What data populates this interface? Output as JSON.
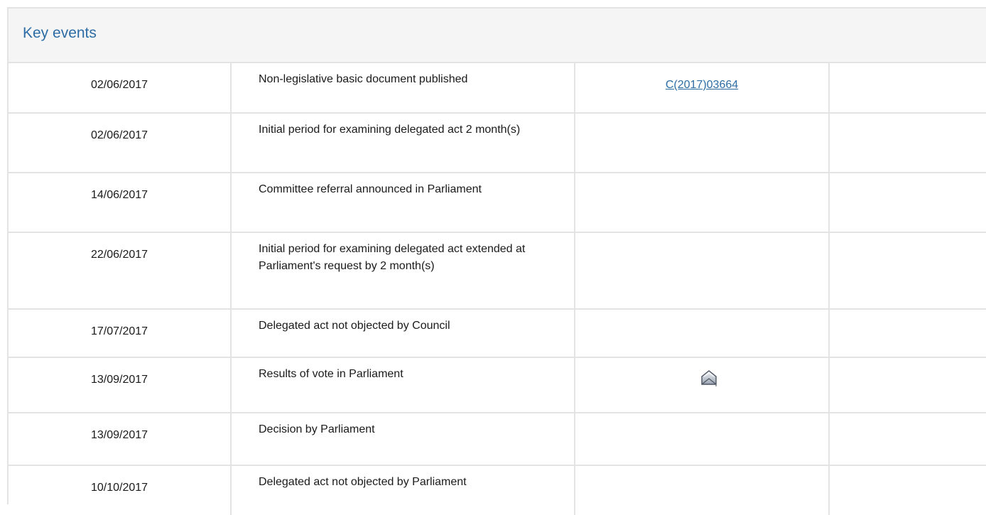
{
  "panel": {
    "title": "Key events"
  },
  "events": [
    {
      "date": "02/06/2017",
      "event": "Non-legislative basic document published",
      "document": "C(2017)03664",
      "icon": null
    },
    {
      "date": "02/06/2017",
      "event": "Initial period for examining delegated act 2 month(s)",
      "document": "",
      "icon": null
    },
    {
      "date": "14/06/2017",
      "event": "Committee referral announced in Parliament",
      "document": "",
      "icon": null
    },
    {
      "date": "22/06/2017",
      "event": "Initial period for examining delegated act extended at Parliament's request by 2 month(s)",
      "document": "",
      "icon": null
    },
    {
      "date": "17/07/2017",
      "event": "Delegated act not objected by Council",
      "document": "",
      "icon": null
    },
    {
      "date": "13/09/2017",
      "event": "Results of vote in Parliament",
      "document": "",
      "icon": "envelope-open-icon"
    },
    {
      "date": "13/09/2017",
      "event": "Decision by Parliament",
      "document": "",
      "icon": null
    },
    {
      "date": "10/10/2017",
      "event": "Delegated act not objected by Parliament",
      "document": "",
      "icon": null
    }
  ],
  "colors": {
    "title": "#2e6da4",
    "link": "#2e6da4",
    "border": "#e3e3e3",
    "header_bg": "#f5f5f5"
  }
}
